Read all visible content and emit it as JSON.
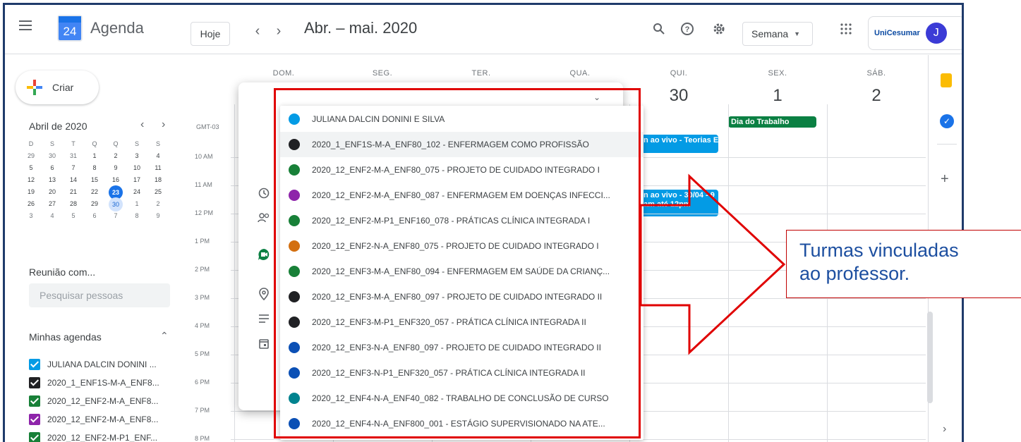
{
  "app": {
    "title": "Agenda",
    "logo_day": "24"
  },
  "toolbar": {
    "today": "Hoje",
    "prev": "‹",
    "next": "›",
    "date_range": "Abr. – mai. 2020",
    "view": "Semana",
    "org": "UniCesumar",
    "avatar": "J"
  },
  "sidebar": {
    "create": "Criar",
    "mini_cal_title": "Abril de 2020",
    "weekday_initials": [
      "D",
      "S",
      "T",
      "Q",
      "Q",
      "S",
      "S"
    ],
    "weeks": [
      [
        "29",
        "30",
        "31",
        "1",
        "2",
        "3",
        "4"
      ],
      [
        "5",
        "6",
        "7",
        "8",
        "9",
        "10",
        "11"
      ],
      [
        "12",
        "13",
        "14",
        "15",
        "16",
        "17",
        "18"
      ],
      [
        "19",
        "20",
        "21",
        "22",
        "23",
        "24",
        "25"
      ],
      [
        "26",
        "27",
        "28",
        "29",
        "30",
        "1",
        "2"
      ],
      [
        "3",
        "4",
        "5",
        "6",
        "7",
        "8",
        "9"
      ]
    ],
    "meeting_title": "Reunião com...",
    "search_placeholder": "Pesquisar pessoas",
    "my_calendars_title": "Minhas agendas",
    "calendars": [
      {
        "label": "JULIANA DALCIN DONINI ...",
        "color": "#039be5"
      },
      {
        "label": "2020_1_ENF1S-M-A_ENF8...",
        "color": "#202124"
      },
      {
        "label": "2020_12_ENF2-M-A_ENF8...",
        "color": "#188038"
      },
      {
        "label": "2020_12_ENF2-M-A_ENF8...",
        "color": "#8e24aa"
      },
      {
        "label": "2020_12_ENF2-M-P1_ENF...",
        "color": "#188038"
      }
    ]
  },
  "grid": {
    "timezone": "GMT-03",
    "days": [
      {
        "name": "DOM.",
        "num": ""
      },
      {
        "name": "SEG.",
        "num": ""
      },
      {
        "name": "TER.",
        "num": ""
      },
      {
        "name": "QUA.",
        "num": ""
      },
      {
        "name": "QUI.",
        "num": "30"
      },
      {
        "name": "SEX.",
        "num": "1"
      },
      {
        "name": "SÁB.",
        "num": "2"
      }
    ],
    "hours": [
      "10 AM",
      "11 AM",
      "12 PM",
      "1 PM",
      "2 PM",
      "3 PM",
      "4 PM",
      "5 PM",
      "6 PM",
      "7 PM",
      "8 PM"
    ],
    "holiday": "Dia do Trabalho",
    "event1": "n ao vivo - Teorias E",
    "event2_line1": "n ao vivo - 30/04 - 9",
    "event2_line2": "am até 12pm"
  },
  "dropdown": {
    "items": [
      {
        "label": "JULIANA DALCIN DONINI E SILVA",
        "color": "#039be5"
      },
      {
        "label": "2020_1_ENF1S-M-A_ENF80_102 - ENFERMAGEM COMO PROFISSÃO",
        "color": "#202124"
      },
      {
        "label": "2020_12_ENF2-M-A_ENF80_075 - PROJETO DE CUIDADO INTEGRADO I",
        "color": "#188038"
      },
      {
        "label": "2020_12_ENF2-M-A_ENF80_087 - ENFERMAGEM EM DOENÇAS INFECCI...",
        "color": "#8e24aa"
      },
      {
        "label": "2020_12_ENF2-M-P1_ENF160_078 - PRÁTICAS CLÍNICA INTEGRADA I",
        "color": "#188038"
      },
      {
        "label": "2020_12_ENF2-N-A_ENF80_075 - PROJETO DE CUIDADO INTEGRADO I",
        "color": "#d36f10"
      },
      {
        "label": "2020_12_ENF3-M-A_ENF80_094 - ENFERMAGEM EM SAÚDE DA CRIANÇ...",
        "color": "#188038"
      },
      {
        "label": "2020_12_ENF3-M-A_ENF80_097 - PROJETO DE CUIDADO INTEGRADO II",
        "color": "#202124"
      },
      {
        "label": "2020_12_ENF3-M-P1_ENF320_057 - PRÁTICA CLÍNICA INTEGRADA II",
        "color": "#202124"
      },
      {
        "label": "2020_12_ENF3-N-A_ENF80_097 - PROJETO DE CUIDADO INTEGRADO II",
        "color": "#0b50b5"
      },
      {
        "label": "2020_12_ENF3-N-P1_ENF320_057 - PRÁTICA CLÍNICA INTEGRADA II",
        "color": "#0b50b5"
      },
      {
        "label": "2020_12_ENF4-N-A_ENF40_082 - TRABALHO DE CONCLUSÃO DE CURSO",
        "color": "#00838f"
      },
      {
        "label": "2020_12_ENF4-N-A_ENF800_001 - ESTÁGIO SUPERVISIONADO NA ATE...",
        "color": "#0b50b5"
      }
    ]
  },
  "annotation": {
    "line1": "Turmas vinculadas",
    "line2": "ao professor."
  }
}
